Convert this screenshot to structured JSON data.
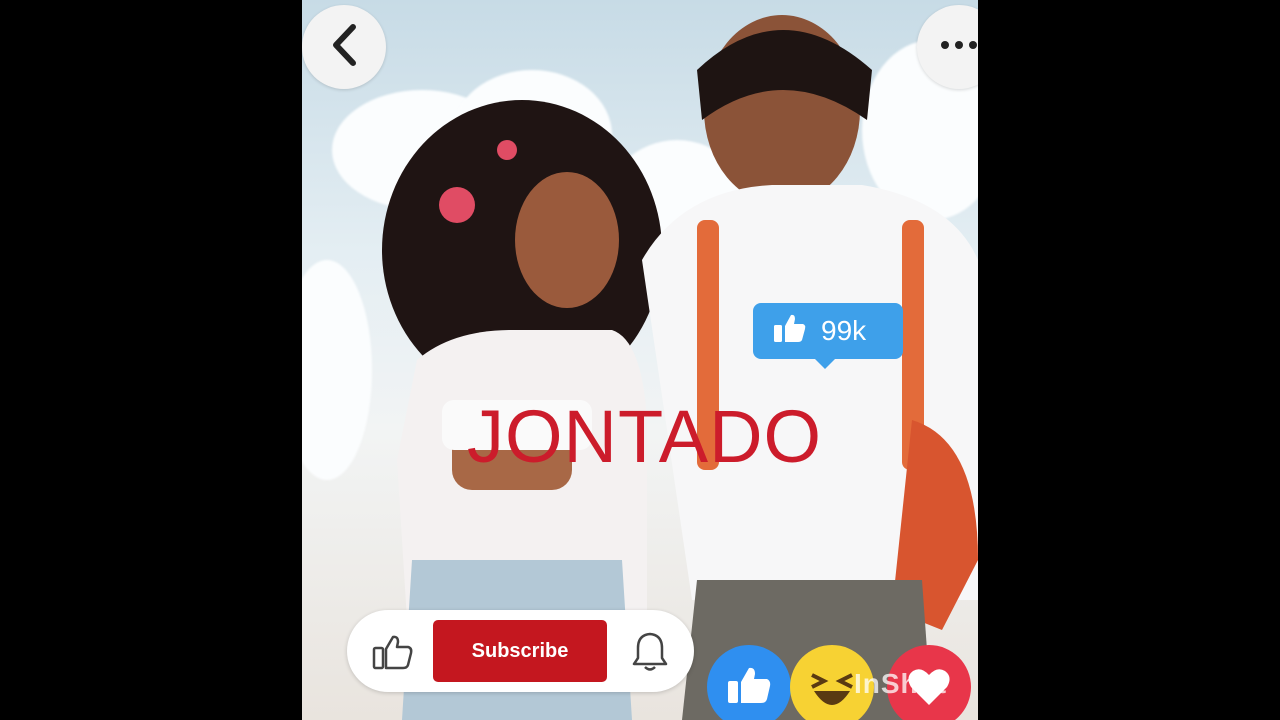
{
  "overlay_title": "JONTADO",
  "like_count": "99k",
  "subscribe_label": "Subscribe",
  "watermark": "InShot",
  "colors": {
    "subscribe_red": "#c4171f",
    "title_red": "#cc1c2b",
    "like_blue": "#3ea0ea"
  },
  "icons": [
    "back-chevron-icon",
    "more-dots-icon",
    "thumbs-up-icon",
    "bell-icon",
    "laugh-emoji-icon",
    "heart-icon"
  ]
}
